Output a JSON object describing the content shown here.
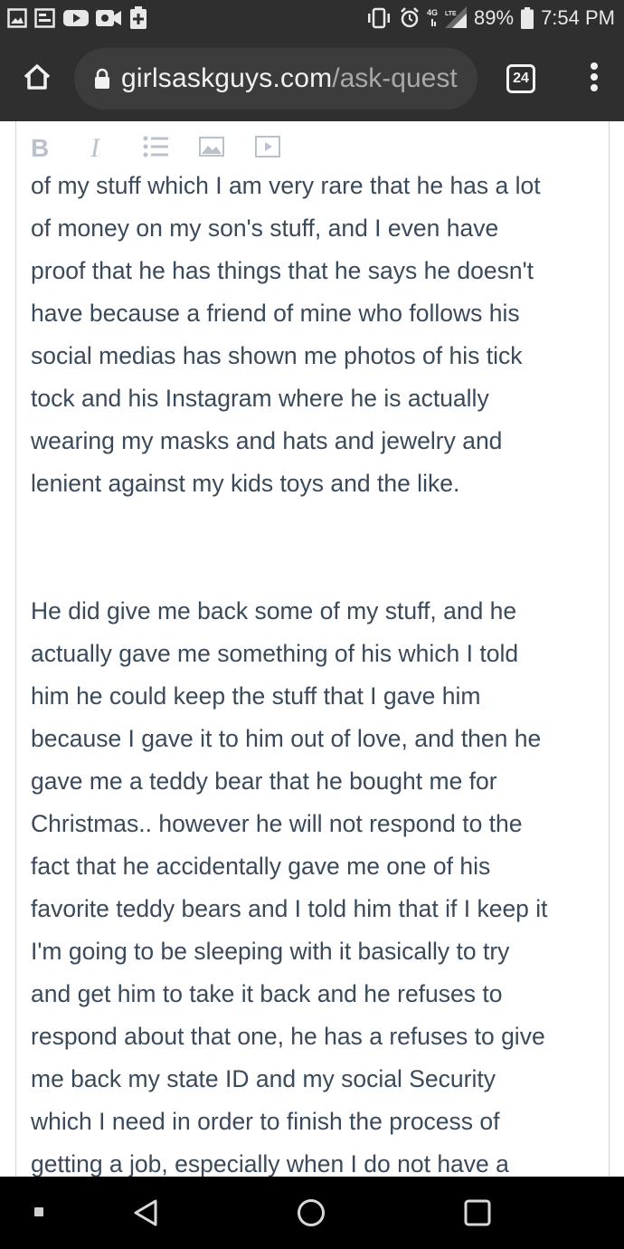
{
  "status_bar": {
    "icons_left": [
      "gallery-icon",
      "app-icon",
      "youtube-icon",
      "video-call-icon",
      "plus-icon"
    ],
    "network_label": "4G LTE",
    "battery_percent": "89%",
    "time": "7:54 PM"
  },
  "browser": {
    "url_domain": "girlsaskguys.com",
    "url_path": "/ask-quest",
    "tab_count": "24"
  },
  "editor": {
    "toolbar": {
      "bold_label": "B",
      "italic_label": "I",
      "list_icon": "list-icon",
      "image_icon": "image-icon",
      "video_icon": "video-icon"
    },
    "paragraph1": [
      "of my stuff which I am very rare that he has a lot",
      "of money on my son's stuff, and I even have",
      "proof that he has things that he says he doesn't",
      "have because a friend of mine who follows his",
      "social medias has shown me photos of his tick",
      "tock and his Instagram where he is actually",
      "wearing my masks and hats and jewelry and",
      "lenient against my kids toys and the like."
    ],
    "paragraph2": [
      "He did give me back some of my stuff, and he",
      "actually gave me something of his which I told",
      "him he could keep the stuff that I gave him",
      "because I gave it to him out of love, and then he",
      "gave me a teddy bear that he bought me for",
      "Christmas.. however he will not respond to the",
      "fact that he accidentally gave me one of his",
      "favorite teddy bears and I told him that if I keep it",
      "I'm going to be sleeping with it basically to try",
      "and get him to take it back and he refuses to",
      "respond about that one, he has a refuses to give",
      "me back my state ID and my social Security",
      "which I need in order to finish the process of",
      "getting a job, especially when I do not have a"
    ]
  },
  "nav_bar": {
    "buttons": [
      "back-icon",
      "home-circle-icon",
      "recents-icon"
    ]
  }
}
